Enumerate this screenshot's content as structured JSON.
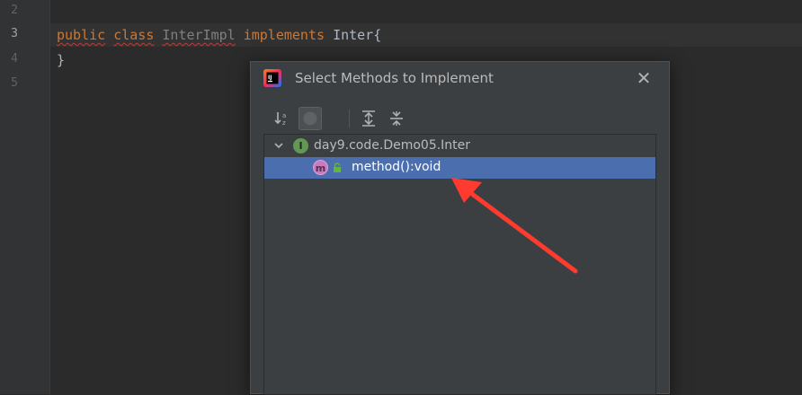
{
  "editor": {
    "line_numbers": [
      "2",
      "3",
      "4",
      "5"
    ],
    "code": {
      "kw_public": "public",
      "kw_class": "class",
      "class_name": "InterImpl",
      "kw_implements": "implements",
      "interface_name": "Inter",
      "open_brace": "{",
      "close_brace": "}"
    }
  },
  "dialog": {
    "title": "Select Methods to Implement",
    "close_glyph": "✕",
    "toolbar": [
      {
        "icon": "sort-alphabetically-icon"
      },
      {
        "icon": "show-classes-icon",
        "pressed": true
      },
      {
        "icon": "expand-all-icon"
      },
      {
        "icon": "collapse-all-icon"
      }
    ],
    "tree": {
      "interface_label": "day9.code.Demo05.Inter",
      "interface_icon_letter": "I",
      "method_label": "method():void",
      "method_icon_letter": "m"
    }
  },
  "colors": {
    "selection": "#4b6eaf",
    "keyword": "#cc7832",
    "annotation_arrow": "#ff3b30"
  }
}
